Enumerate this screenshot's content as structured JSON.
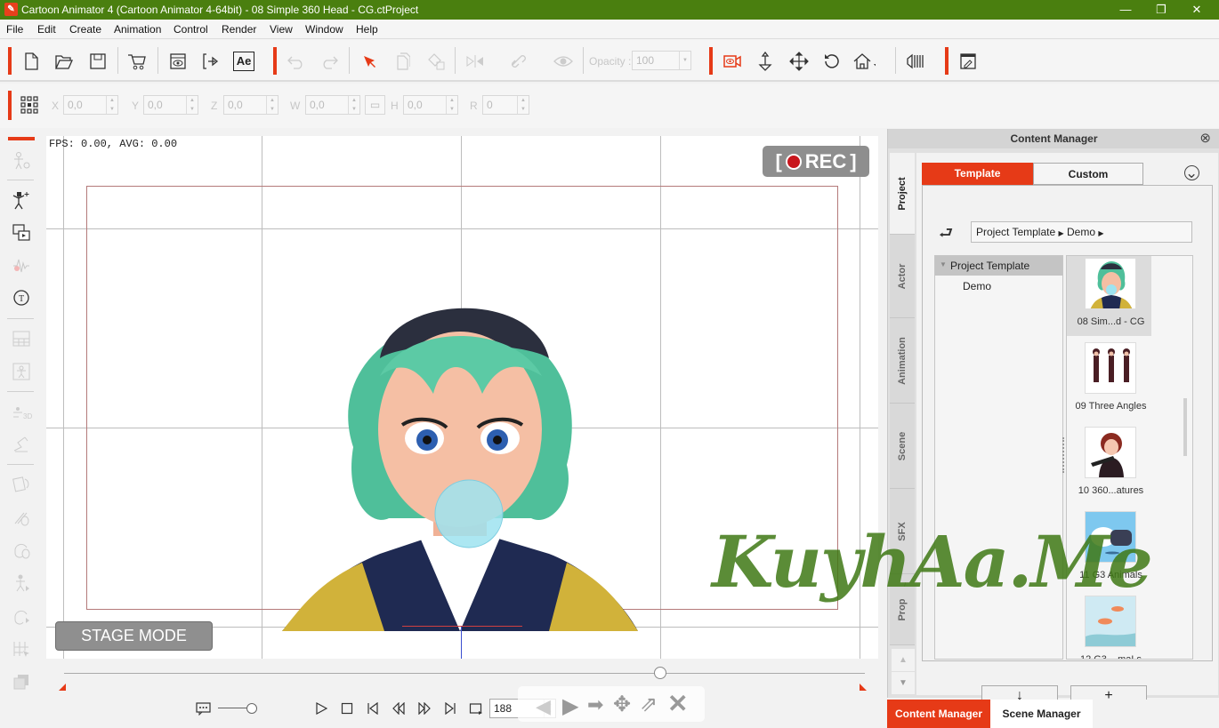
{
  "window": {
    "title": "Cartoon Animator 4  (Cartoon Animator 4-64bit) - 08 Simple 360 Head - CG.ctProject",
    "app_icon": "cartoon-animator-logo",
    "controls": [
      "minimize",
      "restore",
      "close"
    ]
  },
  "menu": [
    "File",
    "Edit",
    "Create",
    "Animation",
    "Control",
    "Render",
    "View",
    "Window",
    "Help"
  ],
  "toolbar": {
    "file_icons": [
      "new-file-icon",
      "open-folder-icon",
      "save-icon",
      "cart-icon",
      "preview-icon",
      "export-icon"
    ],
    "ae_label": "Ae",
    "edit_icons": [
      "undo-icon",
      "redo-icon",
      "select-arrow-icon",
      "duplicate-icon",
      "fill-icon",
      "flip-icon",
      "link-icon",
      "visibility-icon"
    ],
    "opacity_label": "Opacity :",
    "opacity_value": "100",
    "camera_icons": [
      "camera-view-icon",
      "move-z-icon",
      "move-icon",
      "rotate-icon",
      "home-icon",
      "track-icon"
    ],
    "ui_icon": "ui-layout-icon"
  },
  "transform": {
    "x_label": "X",
    "x_value": "0,0",
    "y_label": "Y",
    "y_value": "0,0",
    "z_label": "Z",
    "z_value": "0,0",
    "w_label": "W",
    "w_value": "0,0",
    "h_label": "H",
    "h_value": "0,0",
    "r_label": "R",
    "r_value": "0"
  },
  "stage": {
    "fps_text": "FPS: 0.00, AVG: 0.00",
    "rec_label": "REC",
    "mode_label": "STAGE MODE"
  },
  "timeline": {
    "frame_value": "188",
    "controls": [
      "play",
      "stop",
      "first-frame",
      "prev-key",
      "next-key",
      "last-frame",
      "loop"
    ]
  },
  "content_manager": {
    "title": "Content Manager",
    "side_tabs": [
      "Project",
      "Actor",
      "Animation",
      "Scene",
      "SFX",
      "Prop"
    ],
    "active_side_tab": "Project",
    "tabs": [
      "Template",
      "Custom"
    ],
    "active_tab": "Template",
    "breadcrumb": [
      "Project Template",
      "Demo"
    ],
    "tree": [
      {
        "label": "Project Template",
        "expanded": true
      },
      {
        "label": "Demo"
      }
    ],
    "items": [
      {
        "label": "08 Sim...d - CG",
        "selected": true
      },
      {
        "label": "09 Three Angles"
      },
      {
        "label": "10 360...atures"
      },
      {
        "label": "11 G3 Animals"
      },
      {
        "label": "12 G3 ...maLs"
      }
    ],
    "buttons": {
      "download": "↓",
      "add": "+"
    },
    "bottom_tabs": [
      "Content Manager",
      "Scene Manager"
    ],
    "active_bottom_tab": "Content Manager"
  },
  "watermark": "KuyhAa.Me",
  "colors": {
    "accent": "#e63a17",
    "titlebar": "#4a7f0f",
    "rec_dot": "#c8161d"
  }
}
